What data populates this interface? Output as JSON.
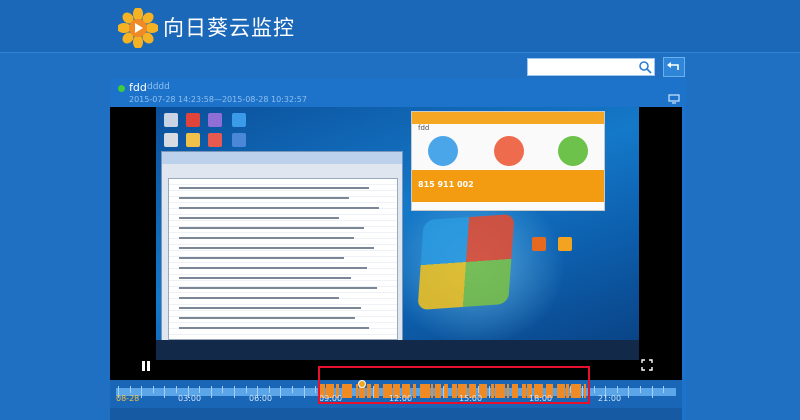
{
  "header": {
    "title": "向日葵云监控"
  },
  "device": {
    "name": "fdd",
    "subtitle": "dddd",
    "time_range": "2015-07-28 14:23:58—2015-08-28 10:32:57",
    "status_color": "#3ecb3e"
  },
  "search": {
    "placeholder": ""
  },
  "client": {
    "name": "fdd",
    "code": "815 911 002"
  },
  "timeline": {
    "date": "08-28",
    "hours": [
      "03:00",
      "06:00",
      "09:00",
      "12:00",
      "15:00",
      "18:00",
      "21:00"
    ]
  },
  "colors": {
    "accent": "#f08a24",
    "highlight": "#e8112d",
    "background": "#1f6fc2"
  }
}
